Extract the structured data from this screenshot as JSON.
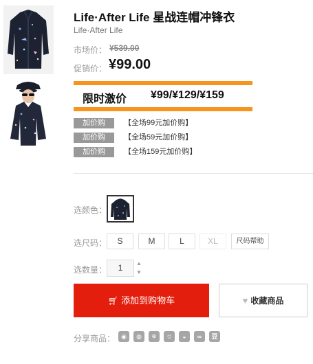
{
  "product": {
    "title": "Life·After Life 星战连帽冲锋衣",
    "brand": "Life·After Life",
    "market_price_label": "市场价：",
    "market_price": "¥539.00",
    "promo_price_label": "促销价：",
    "promo_price": "¥99.00"
  },
  "banner": {
    "label": "限时激价",
    "prices": "¥99/¥129/¥159"
  },
  "promotions": [
    {
      "tag": "加价购",
      "desc": "【全场99元加价购】"
    },
    {
      "tag": "加价购",
      "desc": "【全场59元加价购】"
    },
    {
      "tag": "加价购",
      "desc": "【全场159元加价购】"
    }
  ],
  "options": {
    "color_label": "选颜色：",
    "size_label": "选尺码：",
    "sizes": [
      "S",
      "M",
      "L",
      "XL"
    ],
    "size_help": "尺码帮助",
    "qty_label": "选数量：",
    "qty_value": "1"
  },
  "actions": {
    "add_to_cart": "添加到购物车",
    "favorite": "收藏商品"
  },
  "share": {
    "label": "分享商品：",
    "icons": [
      "weibo-icon",
      "wechat-icon",
      "pengyou-icon",
      "qzone-icon",
      "qq-icon",
      "renren-icon",
      "douban-icon"
    ],
    "douban_text": "豆"
  },
  "colors": {
    "accent": "#e41e0d",
    "banner_orange": "#f7941d",
    "tag_gray": "#999999"
  }
}
